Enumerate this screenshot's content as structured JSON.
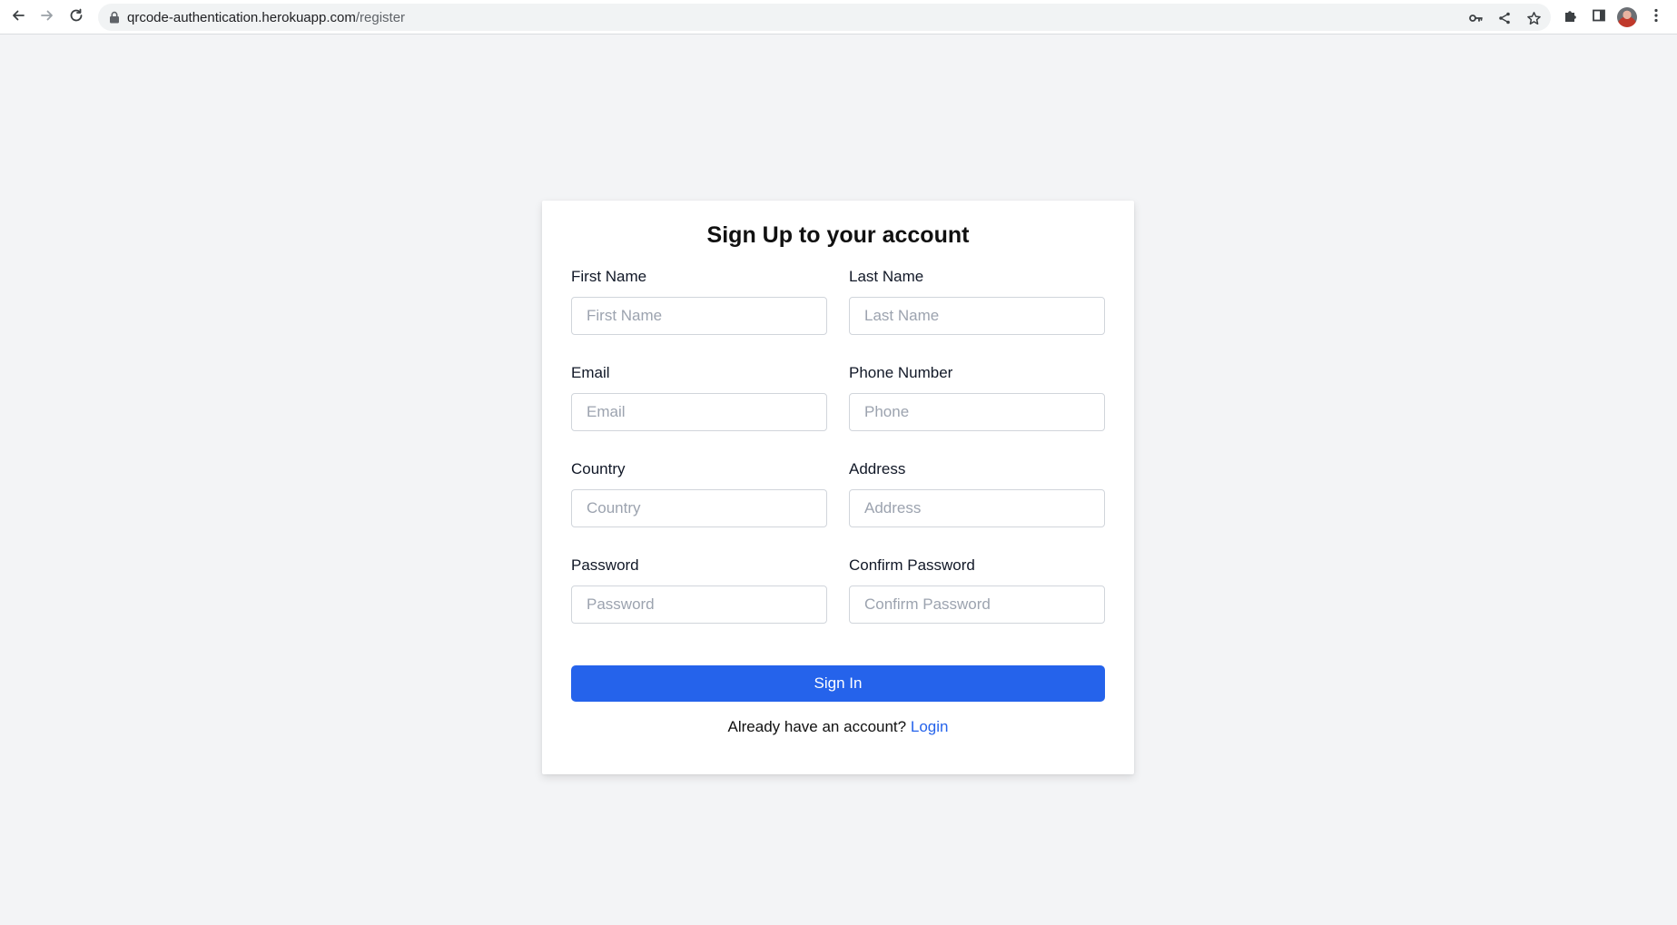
{
  "browser": {
    "url_host": "qrcode-authentication.herokuapp.com",
    "url_path": "/register",
    "back_icon": "arrow-left-icon",
    "forward_icon": "arrow-right-icon",
    "reload_icon": "reload-icon",
    "toolbar_icons": [
      "key-icon",
      "share-icon",
      "star-icon",
      "puzzle-icon",
      "side-panel-icon",
      "avatar",
      "kebab-menu-icon"
    ]
  },
  "form": {
    "title": "Sign Up to your account",
    "fields": {
      "first_name": {
        "label": "First Name",
        "placeholder": "First Name",
        "value": ""
      },
      "last_name": {
        "label": "Last Name",
        "placeholder": "Last Name",
        "value": ""
      },
      "email": {
        "label": "Email",
        "placeholder": "Email",
        "value": ""
      },
      "phone": {
        "label": "Phone Number",
        "placeholder": "Phone",
        "value": ""
      },
      "country": {
        "label": "Country",
        "placeholder": "Country",
        "value": ""
      },
      "address": {
        "label": "Address",
        "placeholder": "Address",
        "value": ""
      },
      "password": {
        "label": "Password",
        "placeholder": "Password",
        "value": ""
      },
      "confirm_password": {
        "label": "Confirm Password",
        "placeholder": "Confirm Password",
        "value": ""
      }
    },
    "submit_label": "Sign In",
    "footer_text": "Already have an account?",
    "login_link": "Login"
  },
  "colors": {
    "page_background": "#f3f4f6",
    "primary": "#2563eb",
    "card_background": "#ffffff"
  }
}
